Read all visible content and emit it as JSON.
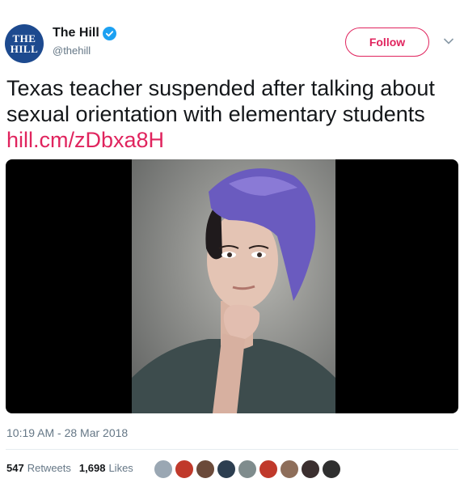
{
  "account": {
    "avatar_line1": "THE",
    "avatar_line2": "HILL",
    "name": "The Hill",
    "handle": "@thehill",
    "verified": true
  },
  "follow_label": "Follow",
  "tweet": {
    "text": "Texas teacher suspended after talking about sexual orientation with elementary students",
    "link": "hill.cm/zDbxa8H"
  },
  "timestamp": "10:19 AM - 28 Mar 2018",
  "stats": {
    "retweets_count": "547",
    "retweets_label": "Retweets",
    "likes_count": "1,698",
    "likes_label": "Likes"
  },
  "likers": [
    {
      "name": "liker-avatar-1",
      "color": "#9aa7b3"
    },
    {
      "name": "liker-avatar-2",
      "color": "#c0392b"
    },
    {
      "name": "liker-avatar-3",
      "color": "#6b4a3a"
    },
    {
      "name": "liker-avatar-4",
      "color": "#2c3e50"
    },
    {
      "name": "liker-avatar-5",
      "color": "#7f8c8d"
    },
    {
      "name": "liker-avatar-6",
      "color": "#c0392b"
    },
    {
      "name": "liker-avatar-7",
      "color": "#8e6e5a"
    },
    {
      "name": "liker-avatar-8",
      "color": "#3b2f2f"
    },
    {
      "name": "liker-avatar-9",
      "color": "#2f2f2f"
    }
  ],
  "colors": {
    "accent": "#e0245e",
    "verified": "#1da1f2",
    "muted": "#657786"
  }
}
